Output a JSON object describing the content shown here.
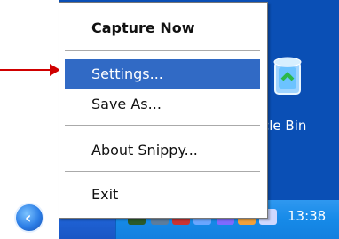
{
  "menu": {
    "items": [
      {
        "label": "Capture Now"
      },
      {
        "label": "Settings..."
      },
      {
        "label": "Save As..."
      },
      {
        "label": "About Snippy..."
      },
      {
        "label": "Exit"
      }
    ]
  },
  "desktop": {
    "recycle_bin_label": "cle Bin"
  },
  "taskbar": {
    "clock": "13:38"
  },
  "colors": {
    "selection": "#316ac5",
    "desktop": "#0a4fb5",
    "taskbar": "#1f63d6",
    "arrow": "#d00000"
  }
}
